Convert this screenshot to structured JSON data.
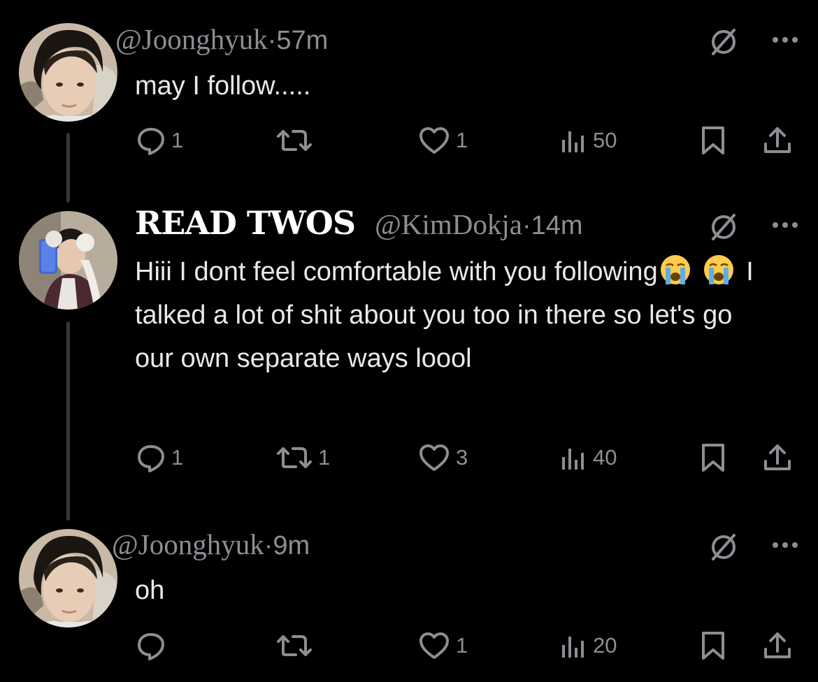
{
  "colors": {
    "background": "#000000",
    "text": "#e7e9ea",
    "muted": "#8b8f94",
    "thread_line": "#333639"
  },
  "posts": [
    {
      "display_name": "",
      "handle": "@Joonghyuk",
      "separator": " · ",
      "time": "57m",
      "text": "may I follow.....",
      "replies": "1",
      "reposts": "",
      "likes": "1",
      "views": "50",
      "icons": [
        "ignore-icon",
        "more-icon",
        "reply-icon",
        "repost-icon",
        "like-icon",
        "views-icon",
        "bookmark-icon",
        "share-icon"
      ]
    },
    {
      "display_name": "READ TWOS",
      "handle": "@KimDokja",
      "separator": " · ",
      "time": "14m",
      "text_part1": "Hiii I dont feel comfortable with you following",
      "emoji": "loudly-crying-face-emoji",
      "text_part2": " I talked a lot of shit about you too in there so let's go our own separate ways loool",
      "replies": "1",
      "reposts": "1",
      "likes": "3",
      "views": "40"
    },
    {
      "display_name": "",
      "handle": "@Joonghyuk",
      "separator": "· ",
      "time": "9m",
      "text": "oh",
      "replies": "",
      "reposts": "",
      "likes": "1",
      "views": "20"
    }
  ]
}
